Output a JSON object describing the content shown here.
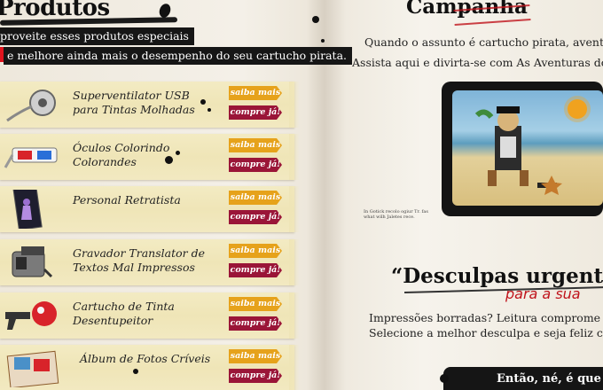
{
  "products": {
    "title": "Produtos",
    "intro_line1": "proveite esses produtos especiais",
    "intro_line2": "e melhore ainda mais o desempenho do seu cartucho pirata.",
    "more_label": "saiba mais",
    "buy_label": "compre já!",
    "items": [
      {
        "name": "Superventilator USB para Tintas Molhadas",
        "icon": "usb-fan-icon"
      },
      {
        "name": "Óculos Colorindo Colorandes",
        "icon": "3d-glasses-icon"
      },
      {
        "name": "Personal Retratista",
        "icon": "photo-card-icon"
      },
      {
        "name": "Gravador Translator de Textos Mal Impressos",
        "icon": "recorder-device-icon"
      },
      {
        "name": "Cartucho de Tinta Desentupeitor",
        "icon": "ink-plunger-icon"
      },
      {
        "name": "Álbum de Fotos Críveis",
        "icon": "photo-album-icon"
      }
    ]
  },
  "campaign": {
    "title": "Campanha",
    "line1": "Quando o assunto é cartucho pirata, aventura é",
    "line2": "Assista aqui e divirta-se com As Aventuras do Cart",
    "video_icon": "pirate-video-icon",
    "note": "In Gotick recolo ogiur Tr. fas what wilh Jaletes rece."
  },
  "excuses": {
    "title": "“Desculpas urgentes",
    "subtitle": "para a sua",
    "line1": "Impressões borradas? Leitura comprome",
    "line2": "Selecione a melhor desculpa e seja feliz co"
  },
  "footer": {
    "text": "Então, né, é que"
  },
  "colors": {
    "more_button": "#e6a21b",
    "buy_button": "#9a1538",
    "accent_red": "#c0141c",
    "ink": "#111111",
    "paper": "#efe5b7"
  }
}
